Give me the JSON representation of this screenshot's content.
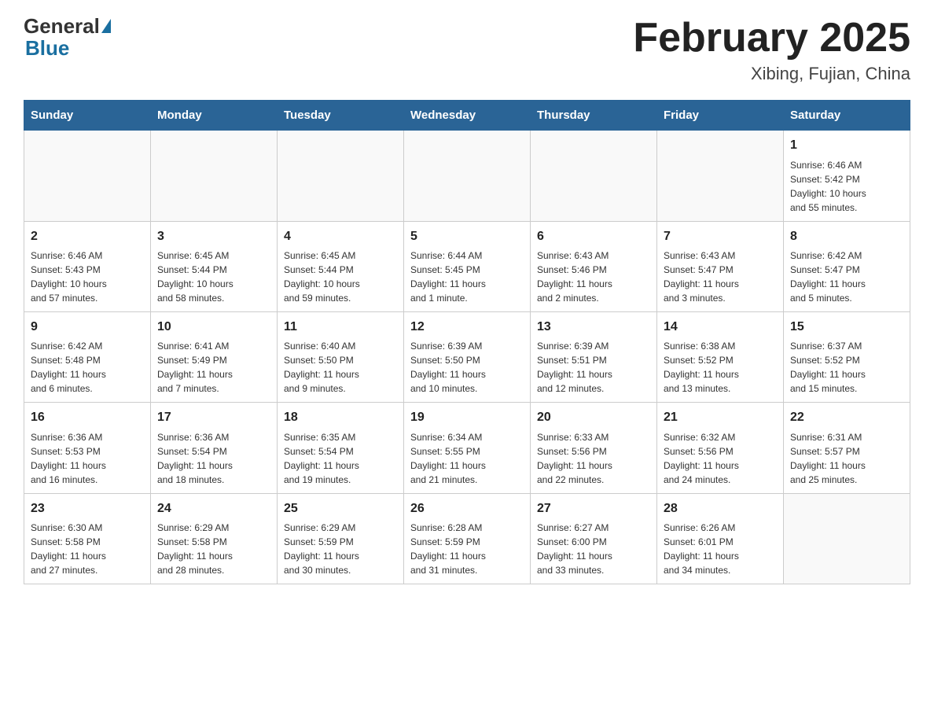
{
  "header": {
    "logo": {
      "general": "General",
      "blue": "Blue"
    },
    "title": "February 2025",
    "location": "Xibing, Fujian, China"
  },
  "weekdays": [
    "Sunday",
    "Monday",
    "Tuesday",
    "Wednesday",
    "Thursday",
    "Friday",
    "Saturday"
  ],
  "weeks": [
    [
      {
        "day": "",
        "info": ""
      },
      {
        "day": "",
        "info": ""
      },
      {
        "day": "",
        "info": ""
      },
      {
        "day": "",
        "info": ""
      },
      {
        "day": "",
        "info": ""
      },
      {
        "day": "",
        "info": ""
      },
      {
        "day": "1",
        "info": "Sunrise: 6:46 AM\nSunset: 5:42 PM\nDaylight: 10 hours\nand 55 minutes."
      }
    ],
    [
      {
        "day": "2",
        "info": "Sunrise: 6:46 AM\nSunset: 5:43 PM\nDaylight: 10 hours\nand 57 minutes."
      },
      {
        "day": "3",
        "info": "Sunrise: 6:45 AM\nSunset: 5:44 PM\nDaylight: 10 hours\nand 58 minutes."
      },
      {
        "day": "4",
        "info": "Sunrise: 6:45 AM\nSunset: 5:44 PM\nDaylight: 10 hours\nand 59 minutes."
      },
      {
        "day": "5",
        "info": "Sunrise: 6:44 AM\nSunset: 5:45 PM\nDaylight: 11 hours\nand 1 minute."
      },
      {
        "day": "6",
        "info": "Sunrise: 6:43 AM\nSunset: 5:46 PM\nDaylight: 11 hours\nand 2 minutes."
      },
      {
        "day": "7",
        "info": "Sunrise: 6:43 AM\nSunset: 5:47 PM\nDaylight: 11 hours\nand 3 minutes."
      },
      {
        "day": "8",
        "info": "Sunrise: 6:42 AM\nSunset: 5:47 PM\nDaylight: 11 hours\nand 5 minutes."
      }
    ],
    [
      {
        "day": "9",
        "info": "Sunrise: 6:42 AM\nSunset: 5:48 PM\nDaylight: 11 hours\nand 6 minutes."
      },
      {
        "day": "10",
        "info": "Sunrise: 6:41 AM\nSunset: 5:49 PM\nDaylight: 11 hours\nand 7 minutes."
      },
      {
        "day": "11",
        "info": "Sunrise: 6:40 AM\nSunset: 5:50 PM\nDaylight: 11 hours\nand 9 minutes."
      },
      {
        "day": "12",
        "info": "Sunrise: 6:39 AM\nSunset: 5:50 PM\nDaylight: 11 hours\nand 10 minutes."
      },
      {
        "day": "13",
        "info": "Sunrise: 6:39 AM\nSunset: 5:51 PM\nDaylight: 11 hours\nand 12 minutes."
      },
      {
        "day": "14",
        "info": "Sunrise: 6:38 AM\nSunset: 5:52 PM\nDaylight: 11 hours\nand 13 minutes."
      },
      {
        "day": "15",
        "info": "Sunrise: 6:37 AM\nSunset: 5:52 PM\nDaylight: 11 hours\nand 15 minutes."
      }
    ],
    [
      {
        "day": "16",
        "info": "Sunrise: 6:36 AM\nSunset: 5:53 PM\nDaylight: 11 hours\nand 16 minutes."
      },
      {
        "day": "17",
        "info": "Sunrise: 6:36 AM\nSunset: 5:54 PM\nDaylight: 11 hours\nand 18 minutes."
      },
      {
        "day": "18",
        "info": "Sunrise: 6:35 AM\nSunset: 5:54 PM\nDaylight: 11 hours\nand 19 minutes."
      },
      {
        "day": "19",
        "info": "Sunrise: 6:34 AM\nSunset: 5:55 PM\nDaylight: 11 hours\nand 21 minutes."
      },
      {
        "day": "20",
        "info": "Sunrise: 6:33 AM\nSunset: 5:56 PM\nDaylight: 11 hours\nand 22 minutes."
      },
      {
        "day": "21",
        "info": "Sunrise: 6:32 AM\nSunset: 5:56 PM\nDaylight: 11 hours\nand 24 minutes."
      },
      {
        "day": "22",
        "info": "Sunrise: 6:31 AM\nSunset: 5:57 PM\nDaylight: 11 hours\nand 25 minutes."
      }
    ],
    [
      {
        "day": "23",
        "info": "Sunrise: 6:30 AM\nSunset: 5:58 PM\nDaylight: 11 hours\nand 27 minutes."
      },
      {
        "day": "24",
        "info": "Sunrise: 6:29 AM\nSunset: 5:58 PM\nDaylight: 11 hours\nand 28 minutes."
      },
      {
        "day": "25",
        "info": "Sunrise: 6:29 AM\nSunset: 5:59 PM\nDaylight: 11 hours\nand 30 minutes."
      },
      {
        "day": "26",
        "info": "Sunrise: 6:28 AM\nSunset: 5:59 PM\nDaylight: 11 hours\nand 31 minutes."
      },
      {
        "day": "27",
        "info": "Sunrise: 6:27 AM\nSunset: 6:00 PM\nDaylight: 11 hours\nand 33 minutes."
      },
      {
        "day": "28",
        "info": "Sunrise: 6:26 AM\nSunset: 6:01 PM\nDaylight: 11 hours\nand 34 minutes."
      },
      {
        "day": "",
        "info": ""
      }
    ]
  ]
}
